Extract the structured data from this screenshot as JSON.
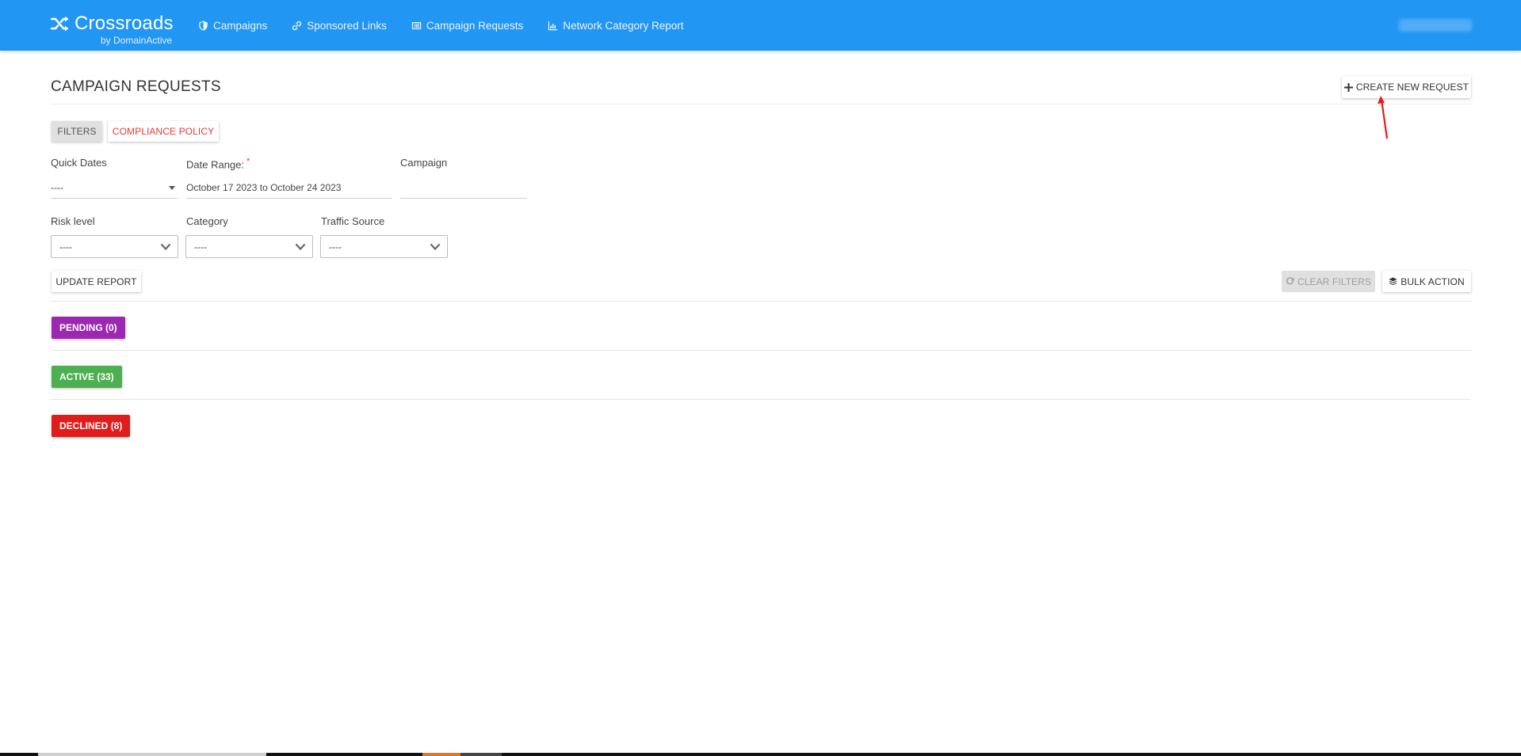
{
  "brand": {
    "name": "Crossroads",
    "subtitle": "by DomainActive"
  },
  "nav": {
    "items": [
      {
        "label": "Campaigns",
        "icon": "shield-icon"
      },
      {
        "label": "Sponsored Links",
        "icon": "link-icon"
      },
      {
        "label": "Campaign Requests",
        "icon": "list-alt-icon"
      },
      {
        "label": "Network Category Report",
        "icon": "bar-chart-icon"
      }
    ]
  },
  "page": {
    "title": "CAMPAIGN REQUESTS",
    "create_button": "CREATE NEW REQUEST"
  },
  "tabs": {
    "filters": "FILTERS",
    "compliance": "COMPLIANCE POLICY"
  },
  "filters": {
    "quick_dates": {
      "label": "Quick Dates",
      "value": "----"
    },
    "date_range": {
      "label": "Date Range:",
      "required_mark": "*",
      "value": "October 17 2023 to October 24 2023"
    },
    "campaign": {
      "label": "Campaign",
      "value": ""
    },
    "risk_level": {
      "label": "Risk level",
      "value": "----"
    },
    "category": {
      "label": "Category",
      "value": "----"
    },
    "traffic_source": {
      "label": "Traffic Source",
      "value": "----"
    }
  },
  "actions": {
    "update_report": "UPDATE REPORT",
    "clear_filters": "CLEAR FILTERS",
    "bulk_action": "BULK ACTION"
  },
  "statuses": {
    "pending": "PENDING (0)",
    "active": "ACTIVE (33)",
    "declined": "DECLINED (8)"
  },
  "colors": {
    "navbar": "#2196f3",
    "pending": "#9c27b0",
    "active": "#4caf50",
    "declined": "#e21b1b",
    "compliance_text": "#e53935",
    "annotation_arrow": "#e31b1b"
  }
}
